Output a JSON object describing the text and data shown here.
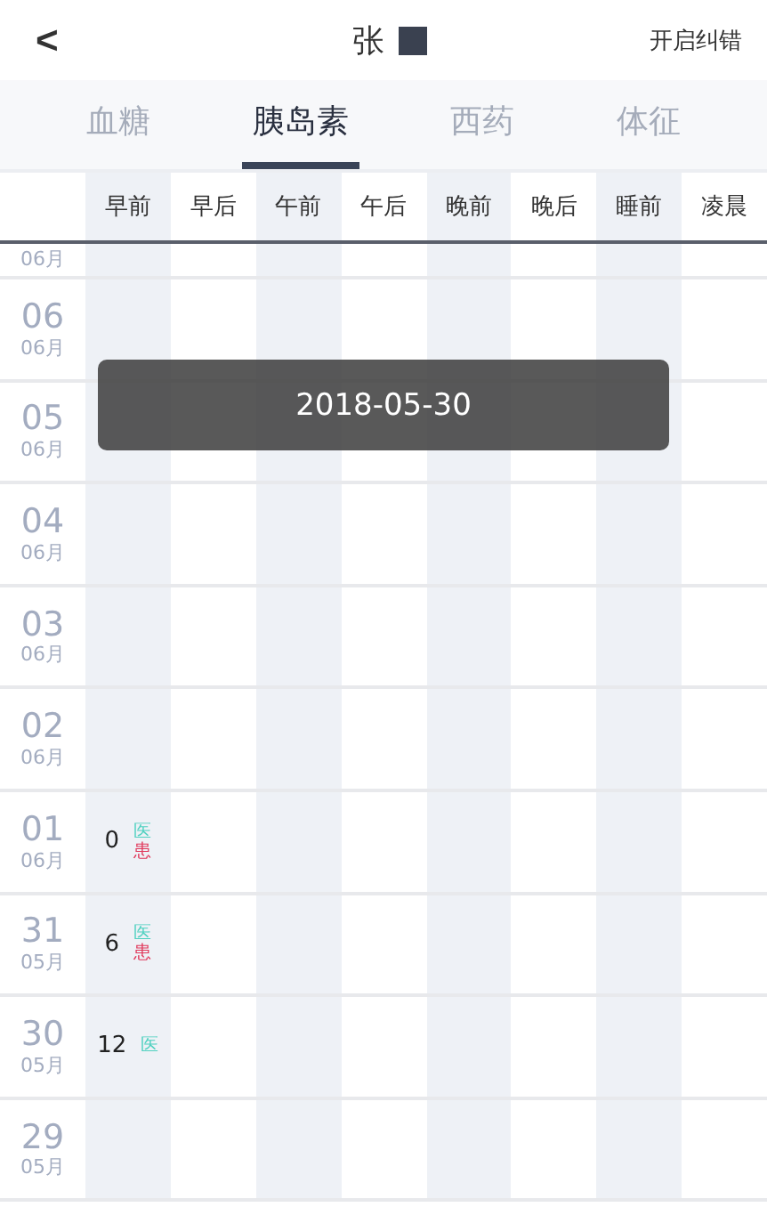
{
  "header": {
    "back": "<",
    "title": "张",
    "action": "开启纠错"
  },
  "tabs": [
    {
      "label": "血糖",
      "selected": false
    },
    {
      "label": "胰岛素",
      "selected": true
    },
    {
      "label": "西药",
      "selected": false
    },
    {
      "label": "体征",
      "selected": false
    }
  ],
  "columns": [
    "早前",
    "早后",
    "午前",
    "午后",
    "晚前",
    "晚后",
    "睡前",
    "凌晨"
  ],
  "partial_row": {
    "month": "06月"
  },
  "rows": [
    {
      "day": "06",
      "month": "06月"
    },
    {
      "day": "05",
      "month": "06月"
    },
    {
      "day": "04",
      "month": "06月"
    },
    {
      "day": "03",
      "month": "06月"
    },
    {
      "day": "02",
      "month": "06月"
    },
    {
      "day": "01",
      "month": "06月",
      "first_cell": {
        "value": "0",
        "tags": [
          {
            "label": "医",
            "color": "#4fd1c0"
          },
          {
            "label": "患",
            "color": "#e0375a"
          }
        ]
      }
    },
    {
      "day": "31",
      "month": "05月",
      "first_cell": {
        "value": "6",
        "tags": [
          {
            "label": "医",
            "color": "#4fd1c0"
          },
          {
            "label": "患",
            "color": "#e0375a"
          }
        ]
      }
    },
    {
      "day": "30",
      "month": "05月",
      "first_cell": {
        "value": "12",
        "tags": [
          {
            "label": "医",
            "color": "#4fd1c0"
          }
        ]
      }
    },
    {
      "day": "29",
      "month": "05月"
    }
  ],
  "toast": "2018-05-30"
}
